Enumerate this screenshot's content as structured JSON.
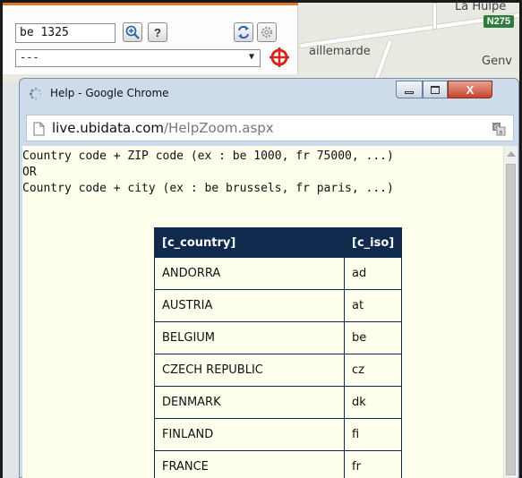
{
  "map": {
    "road_badge": "N275",
    "town_left": "aillemarde",
    "town_right": "Genv",
    "town_top": "La Hulpe"
  },
  "toolbar": {
    "search_value": "be 1325",
    "zoom_icon": "magnifier-plus-icon",
    "help_label": "?",
    "refresh_icon": "refresh-arrows-icon",
    "settings_icon": "gear-icon",
    "select_value": "---",
    "select_arrow": "▼",
    "target_icon": "crosshair-target-icon"
  },
  "window": {
    "title": "Help - Google Chrome",
    "minimize_label": "▭",
    "maximize_label": "□",
    "close_label": "X",
    "url_host": "live.ubidata.com",
    "url_path": "/HelpZoom.aspx"
  },
  "help": {
    "line1": "Country code + ZIP code (ex : be 1000, fr 75000, ...)",
    "line2": "OR",
    "line3": "Country code + city (ex : be brussels, fr paris, ...)"
  },
  "table": {
    "headers": [
      "[c_country]",
      "[c_iso]"
    ],
    "rows": [
      [
        "ANDORRA",
        "ad"
      ],
      [
        "AUSTRIA",
        "at"
      ],
      [
        "BELGIUM",
        "be"
      ],
      [
        "CZECH REPUBLIC",
        "cz"
      ],
      [
        "DENMARK",
        "dk"
      ],
      [
        "FINLAND",
        "fi"
      ],
      [
        "FRANCE",
        "fr"
      ]
    ]
  },
  "colors": {
    "accent_orange": "#e2792a",
    "table_header": "#0f2a4d",
    "page_background": "#ffffee",
    "badge_green": "#2f7d3c"
  }
}
